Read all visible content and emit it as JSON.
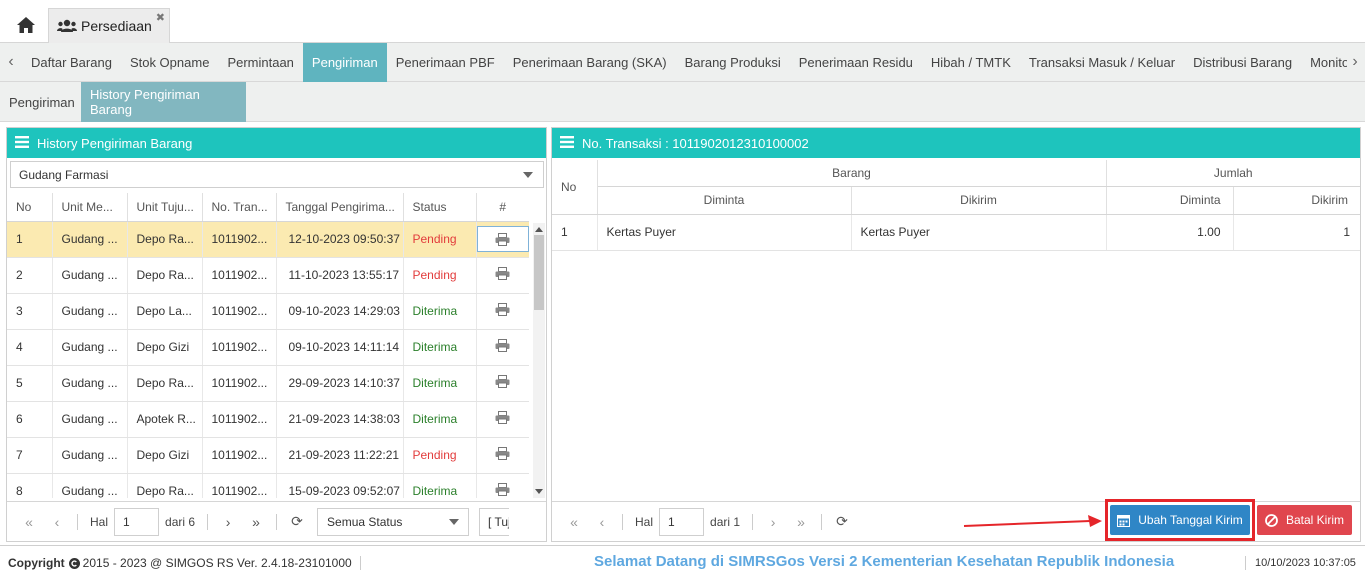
{
  "app_tab": {
    "label": "Persediaan"
  },
  "menu": {
    "items": [
      "Daftar Barang",
      "Stok Opname",
      "Permintaan",
      "Pengiriman",
      "Penerimaan PBF",
      "Penerimaan Barang (SKA)",
      "Barang Produksi",
      "Penerimaan Residu",
      "Hibah / TMTK",
      "Transaksi Masuk / Keluar",
      "Distribusi Barang",
      "Monitoring",
      "Moni"
    ],
    "active_index": 3
  },
  "submenu": {
    "items": [
      "Pengiriman",
      "History Pengiriman Barang"
    ],
    "active_index": 1
  },
  "left_panel": {
    "title": "History Pengiriman Barang",
    "warehouse": "Gudang Farmasi",
    "columns": [
      "No",
      "Unit Me...",
      "Unit Tuju...",
      "No. Tran...",
      "Tanggal Pengirima...",
      "Status",
      "#"
    ],
    "rows": [
      {
        "no": "1",
        "unit": "Gudang ...",
        "tujuan": "Depo Ra...",
        "trans": "1011902...",
        "tanggal": "12-10-2023 09:50:37",
        "status": "Pending"
      },
      {
        "no": "2",
        "unit": "Gudang ...",
        "tujuan": "Depo Ra...",
        "trans": "1011902...",
        "tanggal": "11-10-2023 13:55:17",
        "status": "Pending"
      },
      {
        "no": "3",
        "unit": "Gudang ...",
        "tujuan": "Depo La...",
        "trans": "1011902...",
        "tanggal": "09-10-2023 14:29:03",
        "status": "Diterima"
      },
      {
        "no": "4",
        "unit": "Gudang ...",
        "tujuan": "Depo Gizi",
        "trans": "1011902...",
        "tanggal": "09-10-2023 14:11:14",
        "status": "Diterima"
      },
      {
        "no": "5",
        "unit": "Gudang ...",
        "tujuan": "Depo Ra...",
        "trans": "1011902...",
        "tanggal": "29-09-2023 14:10:37",
        "status": "Diterima"
      },
      {
        "no": "6",
        "unit": "Gudang ...",
        "tujuan": "Apotek R...",
        "trans": "1011902...",
        "tanggal": "21-09-2023 14:38:03",
        "status": "Diterima"
      },
      {
        "no": "7",
        "unit": "Gudang ...",
        "tujuan": "Depo Gizi",
        "trans": "1011902...",
        "tanggal": "21-09-2023 11:22:21",
        "status": "Pending"
      },
      {
        "no": "8",
        "unit": "Gudang ...",
        "tujuan": "Depo Ra...",
        "trans": "1011902...",
        "tanggal": "15-09-2023 09:52:07",
        "status": "Diterima"
      }
    ],
    "pager": {
      "hal_label": "Hal",
      "page": "1",
      "of_label": "dari 6",
      "status_filter": "Semua Status",
      "tujuan_filter": "[ Tuj"
    }
  },
  "right_panel": {
    "title": "No. Transaksi : 1011902012310100002",
    "col_no": "No",
    "group_barang": "Barang",
    "group_jumlah": "Jumlah",
    "sub_diminta": "Diminta",
    "sub_dikirim": "Dikirim",
    "rows": [
      {
        "no": "1",
        "barang_diminta": "Kertas Puyer",
        "barang_dikirim": "Kertas Puyer",
        "jumlah_diminta": "1.00",
        "jumlah_dikirim": "1"
      }
    ],
    "pager": {
      "hal_label": "Hal",
      "page": "1",
      "of_label": "dari 1"
    },
    "btn_ubah": "Ubah Tanggal Kirim",
    "btn_batal": "Batal Kirim"
  },
  "footer": {
    "copyright": "Copyright",
    "copyright_text": "2015 - 2023 @ SIMGOS RS Ver. 2.4.18-23101000",
    "marquee": "Selamat Datang di SIMRSGos Versi 2 Kementerian Kesehatan Republik Indonesia",
    "datetime": "10/10/2023 10:37:05"
  },
  "colors": {
    "header_teal": "#1ec4bd",
    "active_tab": "#5fb4bf",
    "btn_blue": "#2f86c6",
    "btn_red": "#e0464e",
    "highlight": "#e5252a"
  }
}
